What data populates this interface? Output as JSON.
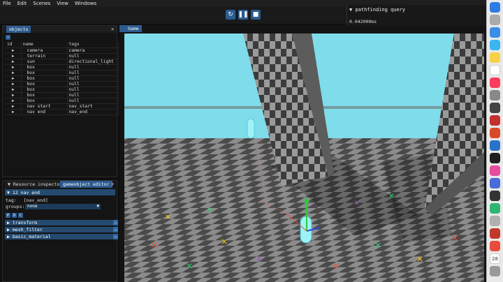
{
  "menubar": {
    "items": [
      "File",
      "Edit",
      "Scenes",
      "View",
      "Windows"
    ]
  },
  "toolbar": {
    "buttons": [
      "reload-icon",
      "pause-icon",
      "stop-icon"
    ]
  },
  "pathfinding": {
    "title": "pathfinding query",
    "value": "0.042000ms"
  },
  "objects": {
    "tab_label": "objects",
    "columns": [
      "id",
      "name",
      "tags"
    ],
    "rows": [
      {
        "name": "camera",
        "tag": "camera"
      },
      {
        "name": "terrain",
        "tag": "null"
      },
      {
        "name": "sun",
        "tag": "directional_light"
      },
      {
        "name": "box",
        "tag": "null"
      },
      {
        "name": "box",
        "tag": "null"
      },
      {
        "name": "box",
        "tag": "null"
      },
      {
        "name": "box",
        "tag": "null"
      },
      {
        "name": "box",
        "tag": "null"
      },
      {
        "name": "box",
        "tag": "null"
      },
      {
        "name": "box",
        "tag": "null"
      },
      {
        "name": "nav start",
        "tag": "nav_start"
      },
      {
        "name": "nav end",
        "tag": "nav_end"
      }
    ]
  },
  "lower": {
    "tabs": [
      "Resource inspector",
      "gameobject editor"
    ],
    "header": "12 nav end",
    "tag_label": "tag:",
    "tag_value": "[nav_end]",
    "groups_label": "groups:",
    "groups_value": "none",
    "pdc": [
      "P",
      "D",
      "C"
    ],
    "components": [
      "transform",
      "mesh_filter",
      "basic_material"
    ]
  },
  "game": {
    "tab_label": "Game"
  },
  "dock": {
    "badge": "28"
  },
  "colors": {
    "accent": "#2c5c8f",
    "sky": "#7fdceb"
  }
}
